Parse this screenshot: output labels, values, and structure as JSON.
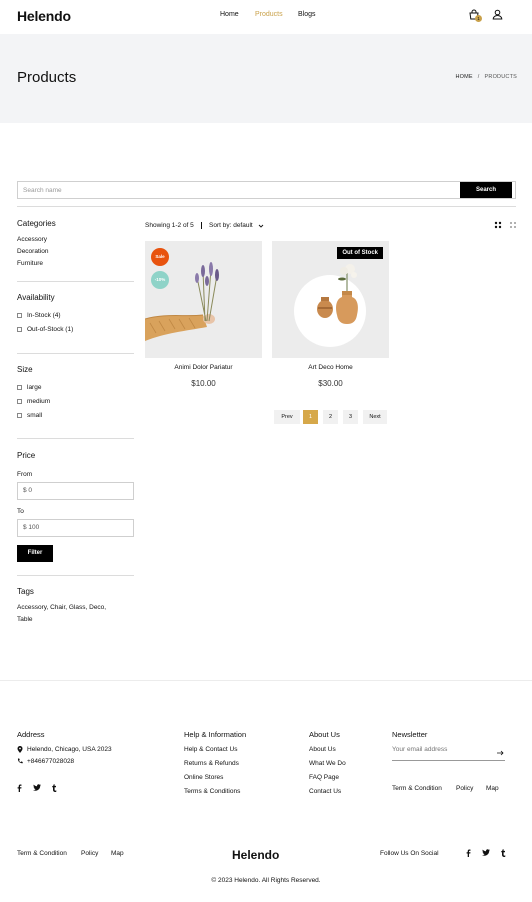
{
  "header": {
    "logo": "Helendo",
    "nav": [
      "Home",
      "Products",
      "Blogs"
    ],
    "active_nav": "Products",
    "cart_count": "1"
  },
  "hero": {
    "title": "Products",
    "breadcrumb": [
      "HOME",
      "PRODUCTS"
    ]
  },
  "search": {
    "placeholder": "Search name",
    "button": "Search"
  },
  "sidebar": {
    "categories_title": "Categories",
    "categories": [
      "Accessory",
      "Decoration",
      "Furniture"
    ],
    "availability_title": "Availability",
    "availability": [
      "In-Stock (4)",
      "Out-of-Stock (1)"
    ],
    "size_title": "Size",
    "sizes": [
      "large",
      "medium",
      "small"
    ],
    "price_title": "Price",
    "from_label": "From",
    "from_value": "$ 0",
    "to_label": "To",
    "to_value": "$ 100",
    "filter_button": "Filter",
    "tags_title": "Tags",
    "tags_line1": "Accessory,  Chair,  Glass,  Deco,",
    "tags_line2": "Table"
  },
  "toolbar": {
    "showing": "Showing 1-2 of 5",
    "sort": "Sort by: default"
  },
  "products": [
    {
      "name": "Animi Dolor Pariatur",
      "price": "$10.00",
      "badge": "Sale",
      "discount": "-10%"
    },
    {
      "name": "Art Deco Home",
      "price": "$30.00",
      "badge": "Out of Stock"
    }
  ],
  "pagination": [
    "Prev",
    "1",
    "2",
    "3",
    "Next"
  ],
  "pagination_active": "1",
  "footer": {
    "address_title": "Address",
    "address": "Helendo, Chicago, USA 2023",
    "phone": "+846677028028",
    "help_title": "Help & Information",
    "help_links": [
      "Help & Contact Us",
      "Returns & Refunds",
      "Online Stores",
      "Terms & Conditions"
    ],
    "about_title": "About Us",
    "about_links": [
      "About Us",
      "What We Do",
      "FAQ Page",
      "Contact Us"
    ],
    "newsletter_title": "Newsletter",
    "newsletter_placeholder": "Your email address",
    "newsletter_links": [
      "Term & Condition",
      "Policy",
      "Map"
    ],
    "bottom_links": [
      "Term & Condition",
      "Policy",
      "Map"
    ],
    "logo": "Helendo",
    "follow": "Follow Us On Social",
    "copyright": "© 2023 Helendo. All Rights Reserved."
  },
  "colors": {
    "accent": "#c9a14a",
    "sale_badge": "#e8530e",
    "discount_badge": "#8fd3c8",
    "hero_bg": "#f3f4f6"
  },
  "icons": [
    "cart-icon",
    "user-icon",
    "grid-icon",
    "list-icon",
    "location-icon",
    "phone-icon",
    "facebook-icon",
    "twitter-icon",
    "tumblr-icon",
    "arrow-right-icon",
    "chevron-down-icon"
  ]
}
